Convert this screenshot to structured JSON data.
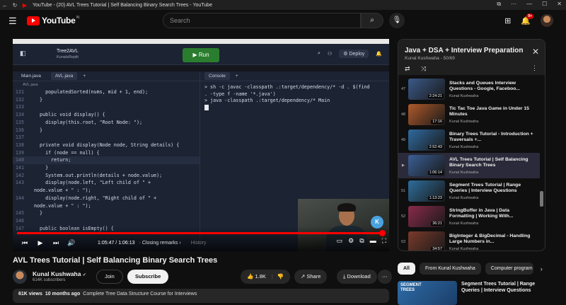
{
  "window": {
    "title": "YouTube - (20) AVL Trees Tutorial | Self Balancing Binary Search Trees - YouTube"
  },
  "header": {
    "logo": "YouTube",
    "logo_sup": "IN",
    "search_placeholder": "Search",
    "notif_count": "9+"
  },
  "editor": {
    "project_name": "Tree2AVL",
    "project_owner": "KunalsReplit",
    "run_label": "Run",
    "deploy_label": "Deploy",
    "tabs": [
      "Main.java",
      "AVL.java"
    ],
    "breadcrumb": "AVL.java",
    "console_tab": "Console",
    "lines": [
      {
        "n": "131",
        "t": "    populatedSorted(nums, mid + 1, end);"
      },
      {
        "n": "132",
        "t": "  }"
      },
      {
        "n": "133",
        "t": ""
      },
      {
        "n": "134",
        "t": "  public void display() {"
      },
      {
        "n": "135",
        "t": "    display(this.root, \"Root Node: \");"
      },
      {
        "n": "136",
        "t": "  }"
      },
      {
        "n": "137",
        "t": ""
      },
      {
        "n": "138",
        "t": "  private void display(Node node, String details) {"
      },
      {
        "n": "139",
        "t": "    if (node == null) {"
      },
      {
        "n": "140",
        "t": "      return;"
      },
      {
        "n": "141",
        "t": "    }"
      },
      {
        "n": "142",
        "t": "    System.out.println(details + node.value);"
      },
      {
        "n": "143",
        "t": "    display(node.left, \"Left child of \" +"
      },
      {
        "n": "",
        "t": "node.value + \" : \");"
      },
      {
        "n": "144",
        "t": "    display(node.right, \"Right child of \" +"
      },
      {
        "n": "",
        "t": "node.value + \" : \");"
      },
      {
        "n": "145",
        "t": "  }"
      },
      {
        "n": "146",
        "t": ""
      },
      {
        "n": "147",
        "t": "  public boolean isEmpty() {"
      }
    ],
    "console_lines": [
      "> sh -c javac -classpath .:target/dependency/* -d . $(find",
      ". -type f -name '*.java')",
      "> java -classpath .:target/dependency/* Main"
    ]
  },
  "player": {
    "time_current": "1:05:47",
    "time_total": "1:06:13",
    "chapter": "Closing remarks",
    "progress": 0.993,
    "history_label": "History"
  },
  "video": {
    "title": "AVL Trees Tutorial | Self Balancing Binary Search Trees",
    "channel": "Kunal Kushwaha",
    "subscribers": "614K subscribers",
    "join_label": "Join",
    "subscribe_label": "Subscribe",
    "likes": "1.8K",
    "share_label": "Share",
    "download_label": "Download",
    "views": "61K views",
    "age": "10 months ago",
    "description": "Complete Tree Data Structure Course for Interviews"
  },
  "playlist": {
    "title": "Java + DSA + Interview Preparation C...",
    "subtitle": "Kunal Kushwaha - 50/69",
    "items": [
      {
        "idx": "47",
        "title": "Stacks and Queues Interview Questions - Google, Faceboo...",
        "channel": "Kunal Kushwaha",
        "duration": "2:24:21",
        "color": "#3b5a8a"
      },
      {
        "idx": "48",
        "title": "Tic Tac Toe Java Game in Under 15 Minutes",
        "channel": "Kunal Kushwaha",
        "duration": "17:16",
        "color": "#b05a2a"
      },
      {
        "idx": "49",
        "title": "Binary Trees Tutorial - Introduction + Traversals +...",
        "channel": "Kunal Kushwaha",
        "duration": "2:52:43",
        "color": "#2f6aa0"
      },
      {
        "idx": "▶",
        "title": "AVL Trees Tutorial | Self Balancing Binary Search Trees",
        "channel": "Kunal Kushwaha",
        "duration": "1:06:14",
        "color": "#3a5f96"
      },
      {
        "idx": "51",
        "title": "Segment Trees Tutorial | Range Queries | Interview Questions",
        "channel": "Kunal Kushwaha",
        "duration": "1:13:23",
        "color": "#2e6d9c"
      },
      {
        "idx": "52",
        "title": "StringBuffer in Java | Data Formatting | Working With...",
        "channel": "Kunal Kushwaha",
        "duration": "36:21",
        "color": "#8a2a4a"
      },
      {
        "idx": "53",
        "title": "BigInteger & BigDecimal - Handling Large Numbers in...",
        "channel": "Kunal Kushwaha",
        "duration": "34:57",
        "color": "#7a3a2a"
      }
    ]
  },
  "chips": [
    "All",
    "From Kunal Kushwaha",
    "Computer program"
  ],
  "recommended": {
    "title": "Segment Trees Tutorial | Range Queries | Interview Questions",
    "thumb_text": "SEGMENT TREES"
  }
}
